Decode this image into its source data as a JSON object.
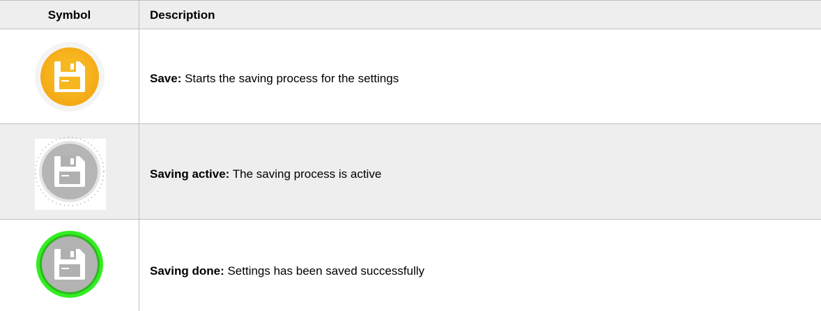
{
  "table": {
    "headers": {
      "symbol": "Symbol",
      "description": "Description"
    },
    "rows": [
      {
        "icon": "save-icon",
        "icon_color": "#f5b21d",
        "term": "Save:",
        "text": " Starts the saving process for the settings"
      },
      {
        "icon": "saving-active-icon",
        "icon_color": "#b3b3b3",
        "term": "Saving active:",
        "text": " The saving process is active"
      },
      {
        "icon": "saving-done-icon",
        "icon_color": "#b3b3b3",
        "ring_color": "#33ee22",
        "term": "Saving done:",
        "text": " Settings has been saved successfully"
      }
    ]
  }
}
